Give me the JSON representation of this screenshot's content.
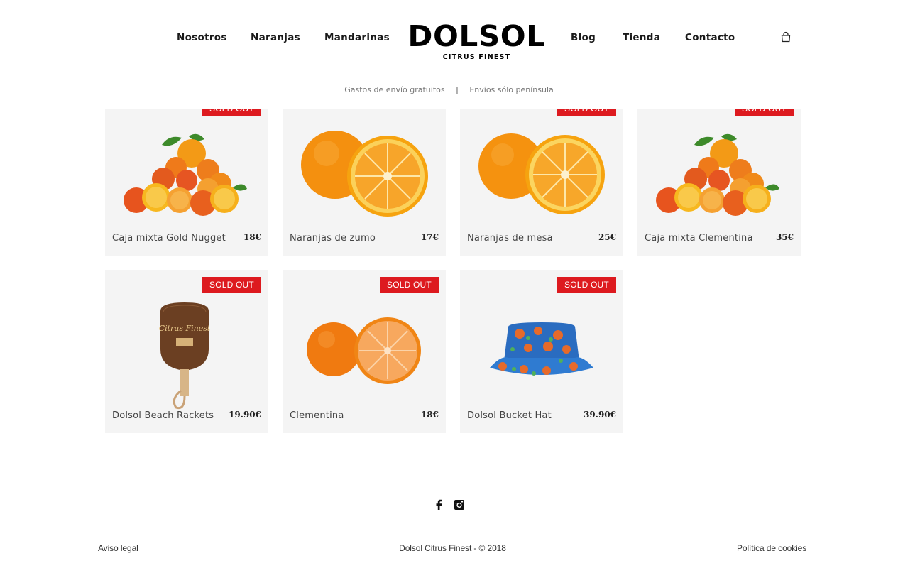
{
  "nav": {
    "left": [
      "Nosotros",
      "Naranjas",
      "Mandarinas"
    ],
    "right": [
      "Blog",
      "Tienda",
      "Contacto"
    ]
  },
  "logo": {
    "main": "DOLSOL",
    "sub": "CITRUS FINEST"
  },
  "shipping": {
    "free": "Gastos de envío gratuitos",
    "separator": "|",
    "region": "Envíos sólo península"
  },
  "badge_label": "SOLD OUT",
  "products": [
    {
      "name": "Caja mixta Gold Nugget",
      "price": "18€",
      "sold_out": true,
      "image": "mixed-citrus-pile"
    },
    {
      "name": "Naranjas de zumo",
      "price": "17€",
      "sold_out": false,
      "image": "juice-orange"
    },
    {
      "name": "Naranjas de mesa",
      "price": "25€",
      "sold_out": true,
      "image": "table-orange"
    },
    {
      "name": "Caja mixta Clementina",
      "price": "35€",
      "sold_out": true,
      "image": "mixed-citrus-pile"
    },
    {
      "name": "Dolsol Beach Rackets",
      "price": "19.90€",
      "sold_out": true,
      "image": "beach-racket"
    },
    {
      "name": "Clementina",
      "price": "18€",
      "sold_out": true,
      "image": "clementine"
    },
    {
      "name": "Dolsol Bucket Hat",
      "price": "39.90€",
      "sold_out": true,
      "image": "bucket-hat"
    }
  ],
  "social": [
    "facebook-icon",
    "instagram-icon"
  ],
  "footer": {
    "legal": "Aviso legal",
    "copyright": "Dolsol Citrus Finest - © 2018",
    "cookies": "Política de cookies"
  },
  "colors": {
    "badge": "#dd1a1f",
    "card_bg": "#f4f4f4",
    "orange": "#f7941d",
    "text": "#1a1a1a"
  }
}
